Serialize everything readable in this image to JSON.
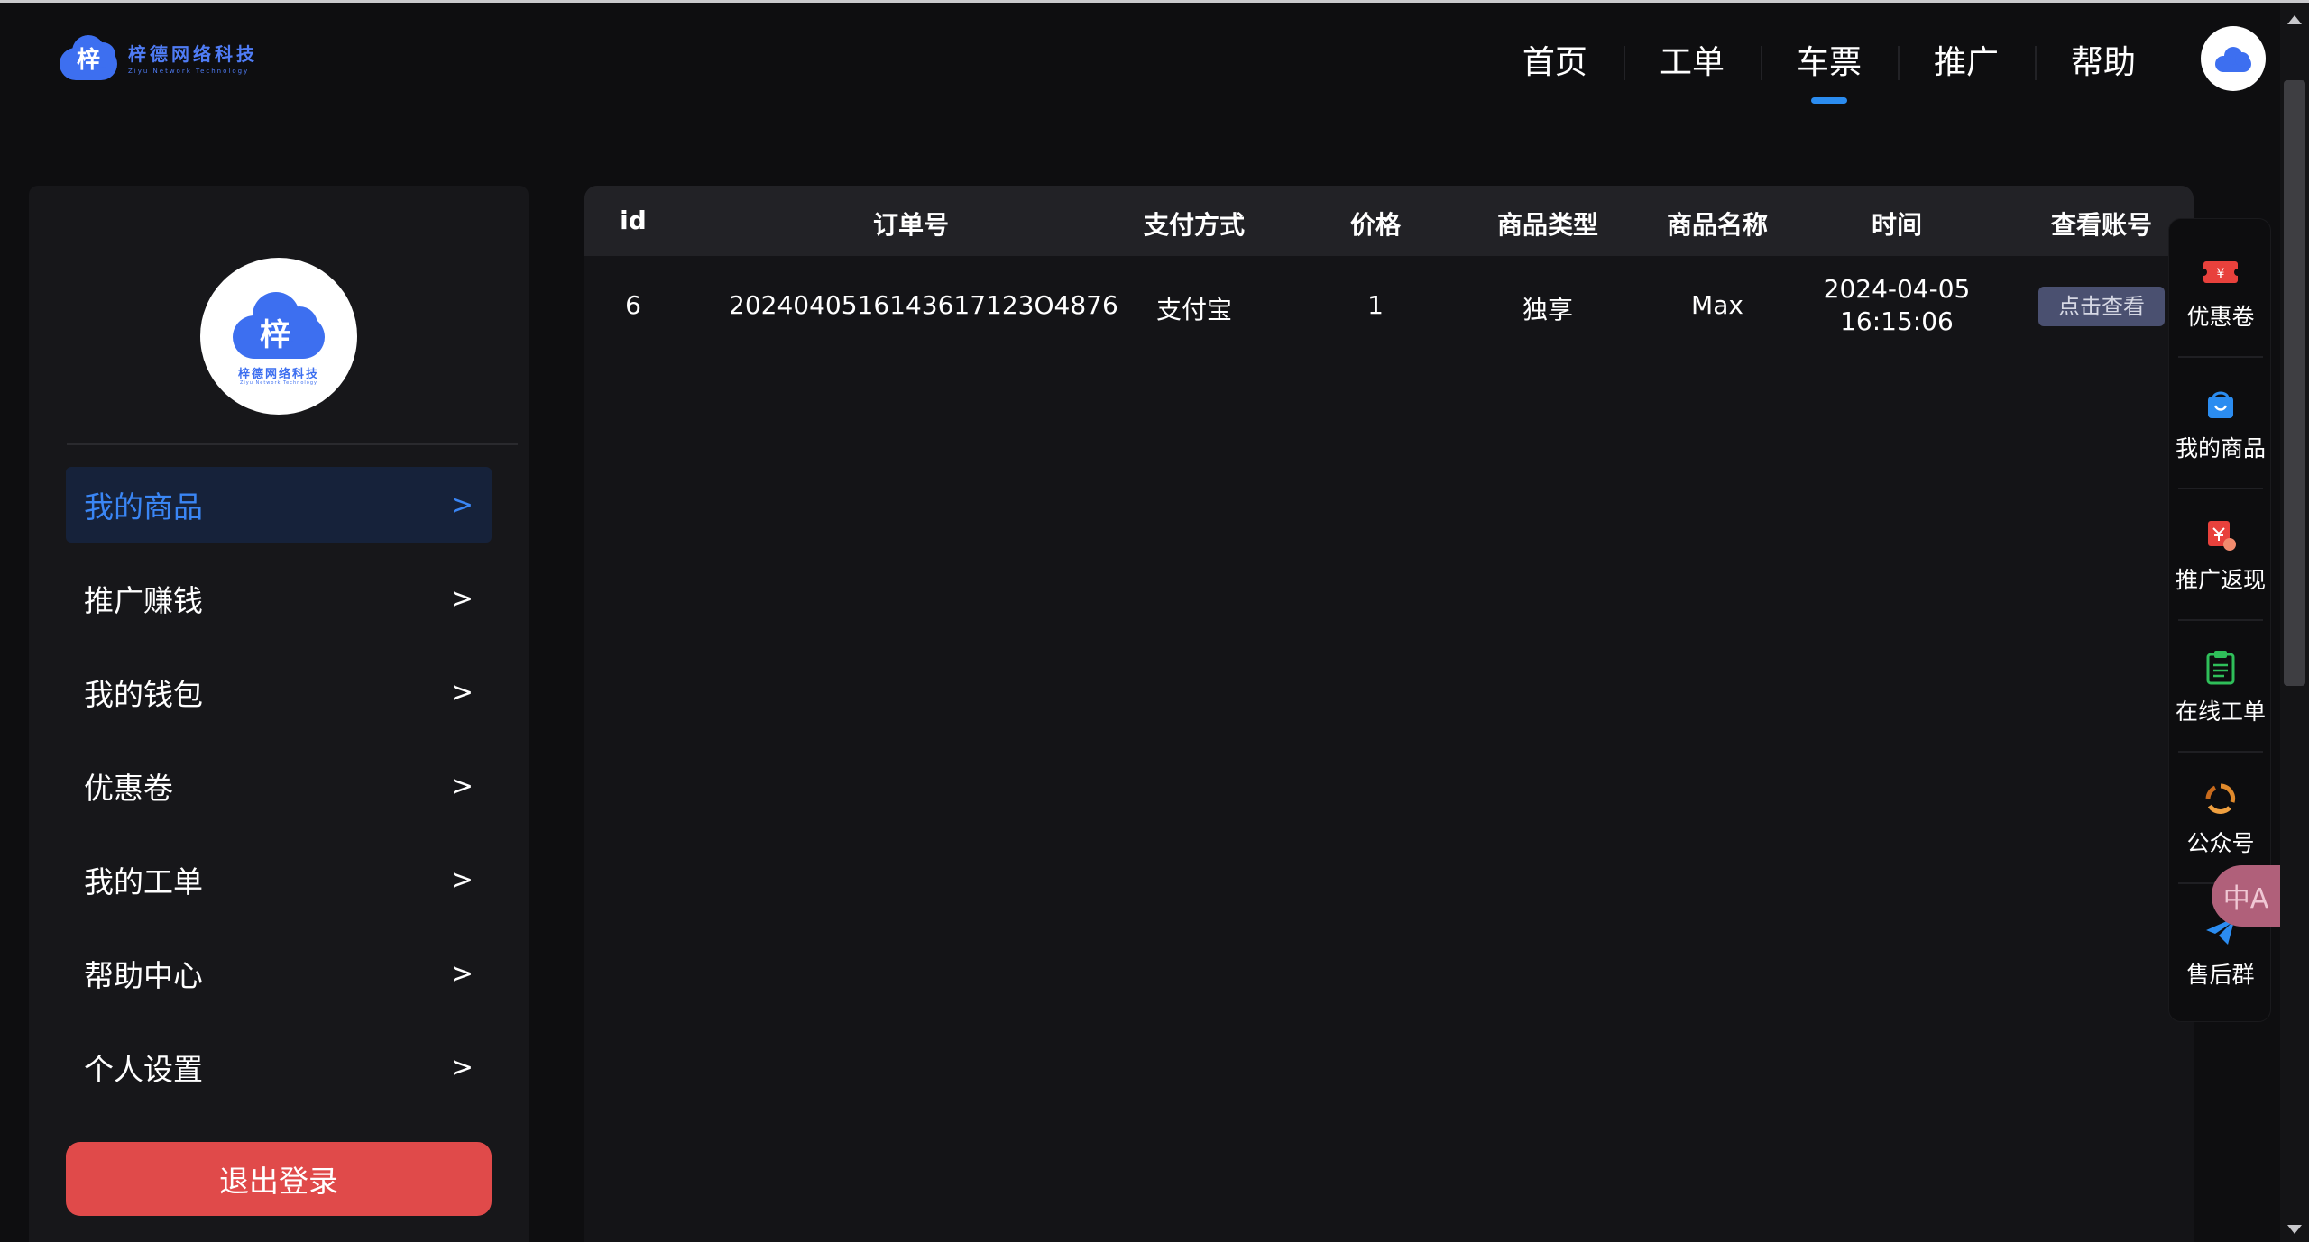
{
  "brand": {
    "name_cn": "梓德网络科技",
    "name_en": "Ziyu Network Technology",
    "mark": "梓"
  },
  "nav": {
    "items": [
      {
        "label": "首页"
      },
      {
        "label": "工单"
      },
      {
        "label": "车票"
      },
      {
        "label": "推广"
      },
      {
        "label": "帮助"
      }
    ],
    "active": "车票"
  },
  "sidebar": {
    "items": [
      {
        "label": "我的商品",
        "arrow": ">"
      },
      {
        "label": "推广赚钱",
        "arrow": ">"
      },
      {
        "label": "我的钱包",
        "arrow": ">"
      },
      {
        "label": "优惠卷",
        "arrow": ">"
      },
      {
        "label": "我的工单",
        "arrow": ">"
      },
      {
        "label": "帮助中心",
        "arrow": ">"
      },
      {
        "label": "个人设置",
        "arrow": ">"
      }
    ],
    "active": "我的商品",
    "logout_label": "退出登录"
  },
  "table": {
    "columns": [
      "id",
      "订单号",
      "支付方式",
      "价格",
      "商品类型",
      "商品名称",
      "时间",
      "查看账号"
    ],
    "rows": [
      {
        "id": "6",
        "order_no": "2024040516143617123O4876",
        "payment": "支付宝",
        "price": "1",
        "type": "独享",
        "name": "Max",
        "date": "2024-04-05",
        "time": "16:15:06",
        "action": "点击查看"
      }
    ]
  },
  "float_panel": {
    "items": [
      {
        "label": "优惠卷",
        "icon": "coupon-icon",
        "color": "#e8413c"
      },
      {
        "label": "我的商品",
        "icon": "shopping-bag-icon",
        "color": "#2b8cf0"
      },
      {
        "label": "推广返现",
        "icon": "cashback-icon",
        "color": "#e8413c"
      },
      {
        "label": "在线工单",
        "icon": "clipboard-icon",
        "color": "#2fbf5a"
      },
      {
        "label": "公众号",
        "icon": "recycle-icon",
        "color": "#e08a2c"
      },
      {
        "label": "售后群",
        "icon": "telegram-icon",
        "color": "#2b8cf0"
      }
    ],
    "translate_badge": "中A"
  },
  "colors": {
    "accent": "#2b8cf0",
    "danger": "#e04a4a",
    "background": "#0e0e10",
    "panel": "#17171a"
  }
}
